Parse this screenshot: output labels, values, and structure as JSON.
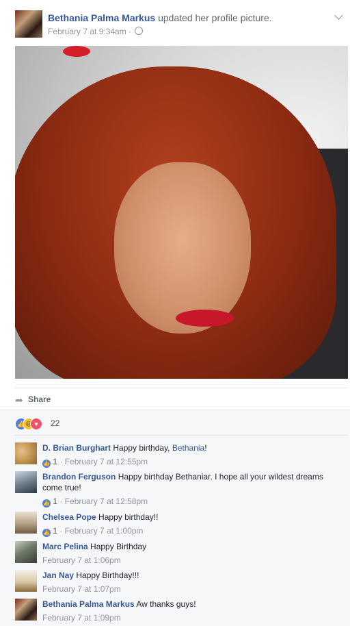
{
  "post": {
    "author": "Bethania Palma Markus",
    "action": "updated her profile picture.",
    "timestamp": "February 7 at 9:34am",
    "separator": "·",
    "privacy_icon": "globe-icon",
    "menu_icon": "chevron-down-icon"
  },
  "actions": {
    "share_label": "Share",
    "share_icon": "share-arrow-icon"
  },
  "reactions": {
    "icons": [
      "like-reaction-icon",
      "haha-reaction-icon",
      "love-reaction-icon"
    ],
    "count": "22"
  },
  "comments": [
    {
      "name": "D. Brian Burghart",
      "text": "Happy birthday, ",
      "link": "Bethania",
      "text_after": "!",
      "likes": "1",
      "time": "February 7 at 12:55pm"
    },
    {
      "name": "Brandon Ferguson",
      "text": "Happy birthday Bethaniar. I hope all your wildest dreams come true!",
      "likes": "1",
      "time": "February 7 at 12:58pm"
    },
    {
      "name": "Chelsea Pope",
      "text": "Happy birthday!!",
      "likes": "1",
      "time": "February 7 at 1:00pm"
    },
    {
      "name": "Marc Pelina",
      "text": "Happy Birthday",
      "time": "February 7 at 1:06pm"
    },
    {
      "name": "Jan Nay",
      "text": "Happy Birthday!!!",
      "time": "February 7 at 1:07pm"
    },
    {
      "name": "Bethania Palma Markus",
      "text": "Aw thanks guys!",
      "time": "February 7 at 1:09pm"
    }
  ],
  "colors": {
    "link": "#365899",
    "meta": "#90949c",
    "like": "#4f7ee0",
    "love": "#f25268",
    "haha": "#f5c33b"
  }
}
